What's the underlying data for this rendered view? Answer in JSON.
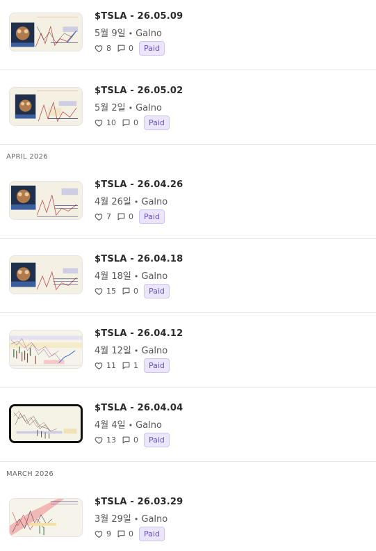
{
  "months": [
    {
      "label": "APRIL 2026"
    },
    {
      "label": "MARCH 2026"
    }
  ],
  "posts": [
    {
      "title": "$TSLA - 26.05.09",
      "date": "5월 9일",
      "author": "Galno",
      "likes": "8",
      "comments": "0",
      "badge": "Paid",
      "thumb_style": "portrait-chart"
    },
    {
      "title": "$TSLA - 26.05.02",
      "date": "5월 2일",
      "author": "Galno",
      "likes": "10",
      "comments": "0",
      "badge": "Paid",
      "thumb_style": "portrait-chart"
    },
    {
      "title": "$TSLA - 26.04.26",
      "date": "4월 26일",
      "author": "Galno",
      "likes": "7",
      "comments": "0",
      "badge": "Paid",
      "thumb_style": "portrait-chart"
    },
    {
      "title": "$TSLA - 26.04.18",
      "date": "4월 18일",
      "author": "Galno",
      "likes": "15",
      "comments": "0",
      "badge": "Paid",
      "thumb_style": "portrait-chart"
    },
    {
      "title": "$TSLA - 26.04.12",
      "date": "4월 12일",
      "author": "Galno",
      "likes": "11",
      "comments": "1",
      "badge": "Paid",
      "thumb_style": "candle-chart"
    },
    {
      "title": "$TSLA - 26.04.04",
      "date": "4월 4일",
      "author": "Galno",
      "likes": "13",
      "comments": "0",
      "badge": "Paid",
      "thumb_style": "dark-frame-chart"
    },
    {
      "title": "$TSLA - 26.03.29",
      "date": "3월 29일",
      "author": "Galno",
      "likes": "9",
      "comments": "0",
      "badge": "Paid",
      "thumb_style": "red-band-chart"
    }
  ],
  "colors": {
    "badge_bg": "#ebe6fb",
    "badge_text": "#6750c9",
    "divider": "#e6e6e6"
  },
  "icons": {
    "like": "heart-icon",
    "comment": "comment-icon"
  }
}
